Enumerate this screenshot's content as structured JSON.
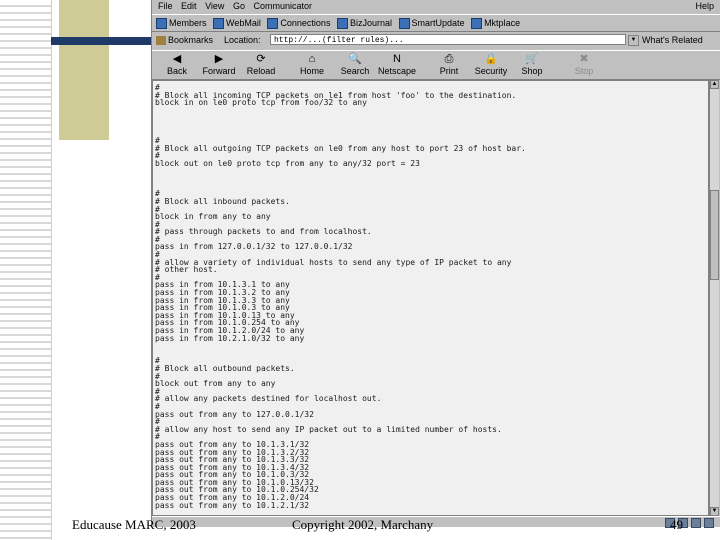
{
  "slide": {
    "footer_left": "Educause MARC, 2003",
    "footer_center": "Copyright 2002, Marchany",
    "page_number": "49"
  },
  "browser": {
    "menu": [
      "File",
      "Edit",
      "View",
      "Go",
      "Communicator"
    ],
    "help": "Help",
    "personal_toolbar": [
      "Members",
      "WebMail",
      "Connections",
      "BizJournal",
      "SmartUpdate",
      "Mktplace"
    ],
    "bookmarks_label": "Bookmarks",
    "location_label": "Location:",
    "url": "http://...(filter rules)...",
    "related_label": "What's Related",
    "nav_buttons": [
      {
        "label": "Back",
        "icon": "◀"
      },
      {
        "label": "Forward",
        "icon": "▶"
      },
      {
        "label": "Reload",
        "icon": "⟳"
      },
      {
        "label": "Home",
        "icon": "⌂"
      },
      {
        "label": "Search",
        "icon": "🔍"
      },
      {
        "label": "Netscape",
        "icon": "N"
      },
      {
        "label": "Print",
        "icon": "⎙"
      },
      {
        "label": "Security",
        "icon": "🔒"
      },
      {
        "label": "Shop",
        "icon": "🛒"
      },
      {
        "label": "Stop",
        "icon": "✖"
      }
    ],
    "document_lines": [
      "#",
      "# Block all incoming TCP packets on le1 from host 'foo' to the destination.",
      "block in on le0 proto tcp from foo/32 to any",
      "",
      "",
      "",
      "",
      "#",
      "# Block all outgoing TCP packets on le0 from any host to port 23 of host bar.",
      "#",
      "block out on le0 proto tcp from any to any/32 port = 23",
      "",
      "",
      "",
      "#",
      "# Block all inbound packets.",
      "#",
      "block in from any to any",
      "#",
      "# pass through packets to and from localhost.",
      "#",
      "pass in from 127.0.0.1/32 to 127.0.0.1/32",
      "#",
      "# allow a variety of individual hosts to send any type of IP packet to any",
      "# other host.",
      "#",
      "pass in from 10.1.3.1 to any",
      "pass in from 10.1.3.2 to any",
      "pass in from 10.1.3.3 to any",
      "pass in from 10.1.0.3 to any",
      "pass in from 10.1.0.13 to any",
      "pass in from 10.1.0.254 to any",
      "pass in from 10.1.2.0/24 to any",
      "pass in from 10.2.1.0/32 to any",
      "",
      "",
      "#",
      "# Block all outbound packets.",
      "#",
      "block out from any to any",
      "#",
      "# allow any packets destined for localhost out.",
      "#",
      "pass out from any to 127.0.0.1/32",
      "#",
      "# allow any host to send any IP packet out to a limited number of hosts.",
      "#",
      "pass out from any to 10.1.3.1/32",
      "pass out from any to 10.1.3.2/32",
      "pass out from any to 10.1.3.3/32",
      "pass out from any to 10.1.3.4/32",
      "pass out from any to 10.1.0.3/32",
      "pass out from any to 10.1.0.13/32",
      "pass out from any to 10.1.0.254/32",
      "pass out from any to 10.1.2.0/24",
      "pass out from any to 10.1.2.1/32"
    ]
  }
}
